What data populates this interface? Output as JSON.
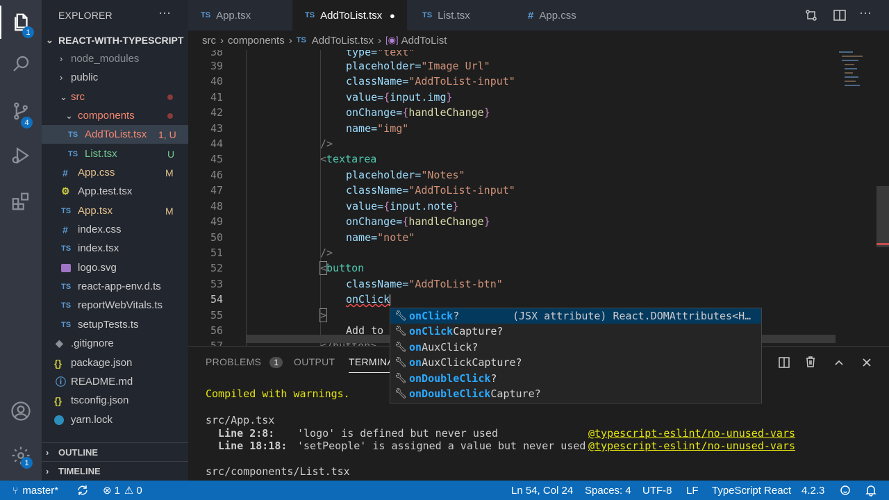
{
  "explorer": {
    "title": "EXPLORER",
    "more": "···",
    "project": "REACT-WITH-TYPESCRIPT",
    "items": [
      {
        "label": "node_modules",
        "status": ""
      },
      {
        "label": "public",
        "status": ""
      },
      {
        "label": "src",
        "status": ""
      },
      {
        "label": "components",
        "status": ""
      },
      {
        "label": "AddToList.tsx",
        "status": "1, U"
      },
      {
        "label": "List.tsx",
        "status": "U"
      },
      {
        "label": "App.css",
        "status": "M"
      },
      {
        "label": "App.test.tsx",
        "status": ""
      },
      {
        "label": "App.tsx",
        "status": "M"
      },
      {
        "label": "index.css",
        "status": ""
      },
      {
        "label": "index.tsx",
        "status": ""
      },
      {
        "label": "logo.svg",
        "status": ""
      },
      {
        "label": "react-app-env.d.ts",
        "status": ""
      },
      {
        "label": "reportWebVitals.ts",
        "status": ""
      },
      {
        "label": "setupTests.ts",
        "status": ""
      },
      {
        "label": ".gitignore",
        "status": ""
      },
      {
        "label": "package.json",
        "status": ""
      },
      {
        "label": "README.md",
        "status": ""
      },
      {
        "label": "tsconfig.json",
        "status": ""
      },
      {
        "label": "yarn.lock",
        "status": ""
      }
    ],
    "outline": "OUTLINE",
    "timeline": "TIMELINE"
  },
  "activity_badges": {
    "explorer": "1",
    "scm": "4",
    "settings": "1"
  },
  "tabs": [
    {
      "label": "App.tsx",
      "icon": "TS"
    },
    {
      "label": "AddToList.tsx",
      "icon": "TS",
      "dirty": "●"
    },
    {
      "label": "List.tsx",
      "icon": "TS"
    },
    {
      "label": "App.css",
      "icon": "#"
    }
  ],
  "breadcrumb": {
    "p1": "src",
    "p2": "components",
    "p3": "AddToList.tsx",
    "p4": "AddToList"
  },
  "editor": {
    "line_numbers": [
      "38",
      "39",
      "40",
      "41",
      "42",
      "43",
      "44",
      "45",
      "46",
      "47",
      "48",
      "49",
      "50",
      "51",
      "52",
      "53",
      "54",
      "55",
      "56",
      "57"
    ],
    "lines": {
      "l38a": "type=",
      "l38b": "\"text\"",
      "l39a": "placeholder=",
      "l39b": "\"Image Url\"",
      "l40a": "className=",
      "l40b": "\"AddToList-input\"",
      "l41a": "value=",
      "l41b": "{",
      "l41c": "input.img",
      "l41d": "}",
      "l42a": "onChange=",
      "l42b": "{",
      "l42c": "handleChange",
      "l42d": "}",
      "l43a": "name=",
      "l43b": "\"img\"",
      "l44": "/>",
      "l45a": "<",
      "l45b": "textarea",
      "l46a": "placeholder=",
      "l46b": "\"Notes\"",
      "l47a": "className=",
      "l47b": "\"AddToList-input\"",
      "l48a": "value=",
      "l48b": "{",
      "l48c": "input.note",
      "l48d": "}",
      "l49a": "onChange=",
      "l49b": "{",
      "l49c": "handleChange",
      "l49d": "}",
      "l50a": "name=",
      "l50b": "\"note\"",
      "l51": "/>",
      "l52a": "<",
      "l52b": "button",
      "l53a": "className=",
      "l53b": "\"AddToList-btn\"",
      "l54": "onClick",
      "l55": ">",
      "l56": "Add to",
      "l57": "</button>"
    }
  },
  "autocomplete": [
    {
      "pre": "",
      "hl": "onClick",
      "post": "?",
      "detail": "(JSX attribute) React.DOMAttributes<H…"
    },
    {
      "pre": "",
      "hl": "onClick",
      "post": "Capture?",
      "detail": ""
    },
    {
      "pre": "on",
      "hl": "AuxClick",
      "post": "?",
      "detail": ""
    },
    {
      "pre": "on",
      "hl": "AuxClick",
      "post": "Capture?",
      "detail": ""
    },
    {
      "pre": "onDouble",
      "hl": "Click",
      "post": "?",
      "detail": ""
    },
    {
      "pre": "onDouble",
      "hl": "Click",
      "post": "Capture?",
      "detail": ""
    }
  ],
  "panel": {
    "problems": "PROBLEMS",
    "problems_count": "1",
    "output": "OUTPUT",
    "terminal": "TERMINA",
    "t1": "Compiled with warnings.",
    "t2": "src/App.tsx",
    "t3a": "  Line 2:8:",
    "t3b": "'logo' is defined but never used",
    "t3c": "@typescript-eslint/no-unused-vars",
    "t4a": "  Line 18:18:",
    "t4b": "'setPeople' is assigned a value but never used",
    "t4c": "@typescript-eslint/no-unused-vars",
    "t5": "src/components/List.tsx"
  },
  "status": {
    "branch": "master*",
    "errors": "1",
    "warnings": "0",
    "position": "Ln 54, Col 24",
    "spaces": "Spaces: 4",
    "encoding": "UTF-8",
    "eol": "LF",
    "language": "TypeScript React",
    "version": "4.2.3"
  },
  "colors": {
    "accent": "#0c6ab8",
    "untracked": "#73c991",
    "modified": "#e2c08d",
    "error": "#f48771"
  }
}
